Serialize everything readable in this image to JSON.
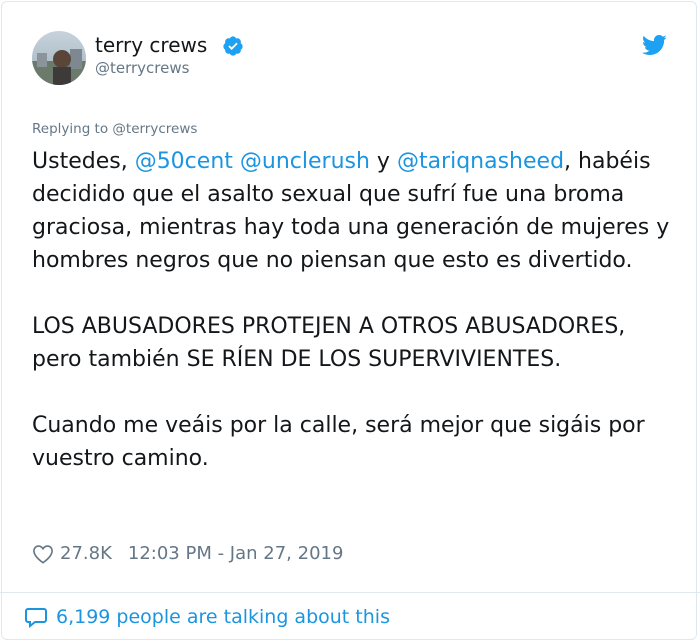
{
  "user": {
    "name": "terry crews",
    "handle": "@terrycrews",
    "verified": true,
    "avatar": "profile-photo"
  },
  "icons": {
    "verified": "verified-badge-icon",
    "brand": "twitter-bird-icon",
    "like": "heart-icon",
    "conversation": "speech-bubble-icon"
  },
  "colors": {
    "accent": "#1b95e0",
    "secondary_text": "#657786",
    "border": "#e1e8ed"
  },
  "tweet": {
    "replying_to": "Replying to @terrycrews",
    "p1_intro": "Ustedes, ",
    "mention_1": "@50cent",
    "mention_2": "@unclerush",
    "p1_y": " y ",
    "mention_3": "@tariqnasheed",
    "p1_rest": ", habéis decidido que el asalto sexual que sufrí fue una broma graciosa, mientras hay toda una generación de mujeres y hombres negros que no piensan que esto es divertido.",
    "p2": "LOS ABUSADORES PROTEJEN A OTROS ABUSADORES, pero también SE RÍEN DE LOS SUPERVIVIENTES.",
    "p3": "Cuando me veáis por la calle, será mejor que sigáis por vuestro camino."
  },
  "meta": {
    "likes": "27.8K",
    "timestamp": "12:03 PM - Jan 27, 2019"
  },
  "footer": {
    "conversation": "6,199 people are talking about this"
  }
}
